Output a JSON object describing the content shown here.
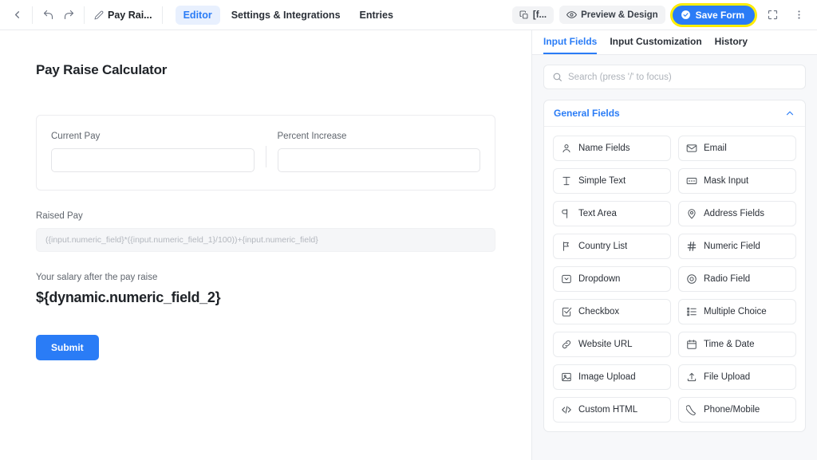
{
  "topbar": {
    "back_icon": "chevron-left-icon",
    "undo_icon": "undo-arrow-icon",
    "redo_icon": "redo-arrow-icon",
    "edit_icon": "pencil-icon",
    "doc_title": "Pay Rai...",
    "tabs": [
      {
        "label": "Editor",
        "active": true
      },
      {
        "label": "Settings & Integrations",
        "active": false
      },
      {
        "label": "Entries",
        "active": false
      }
    ],
    "copy_chip": {
      "icon": "copy-icon",
      "label": "[f..."
    },
    "preview_button": {
      "icon": "eye-icon",
      "label": "Preview & Design"
    },
    "save_button": {
      "icon": "check-circle-icon",
      "label": "Save Form",
      "bg": "#2a7cf6",
      "highlight_ring": "#fff200"
    },
    "fullscreen_icon": "fullscreen-icon",
    "more_icon": "kebab-menu-icon"
  },
  "canvas": {
    "form_title": "Pay Raise Calculator",
    "fields": [
      {
        "label": "Current Pay",
        "value": "",
        "placeholder": ""
      },
      {
        "label": "Percent Increase",
        "value": "",
        "placeholder": ""
      }
    ],
    "raised_pay": {
      "label": "Raised Pay",
      "formula": "({input.numeric_field}*({input.numeric_field_1}/100))+{input.numeric_field}"
    },
    "result": {
      "label": "Your salary after the pay raise",
      "value": "${dynamic.numeric_field_2}"
    },
    "submit_label": "Submit"
  },
  "panel": {
    "tabs": [
      {
        "label": "Input Fields",
        "active": true
      },
      {
        "label": "Input Customization",
        "active": false
      },
      {
        "label": "History",
        "active": false
      }
    ],
    "search": {
      "icon": "search-icon",
      "value": "",
      "placeholder": "Search (press '/' to focus)"
    },
    "group": {
      "title": "General Fields",
      "collapse_icon": "chevron-up-icon",
      "accent": "#2a7cf6",
      "items": [
        {
          "label": "Name Fields",
          "icon": "user-icon"
        },
        {
          "label": "Email",
          "icon": "envelope-icon"
        },
        {
          "label": "Simple Text",
          "icon": "text-height-icon"
        },
        {
          "label": "Mask Input",
          "icon": "mask-input-icon"
        },
        {
          "label": "Text Area",
          "icon": "text-area-icon"
        },
        {
          "label": "Address Fields",
          "icon": "map-pin-icon"
        },
        {
          "label": "Country List",
          "icon": "flag-icon"
        },
        {
          "label": "Numeric Field",
          "icon": "hash-icon"
        },
        {
          "label": "Dropdown",
          "icon": "dropdown-icon"
        },
        {
          "label": "Radio Field",
          "icon": "radio-circle-icon"
        },
        {
          "label": "Checkbox",
          "icon": "checkbox-icon"
        },
        {
          "label": "Multiple Choice",
          "icon": "list-choice-icon"
        },
        {
          "label": "Website URL",
          "icon": "link-icon"
        },
        {
          "label": "Time & Date",
          "icon": "calendar-icon"
        },
        {
          "label": "Image Upload",
          "icon": "image-icon"
        },
        {
          "label": "File Upload",
          "icon": "upload-icon"
        },
        {
          "label": "Custom HTML",
          "icon": "code-icon"
        },
        {
          "label": "Phone/Mobile",
          "icon": "phone-icon"
        }
      ]
    }
  }
}
